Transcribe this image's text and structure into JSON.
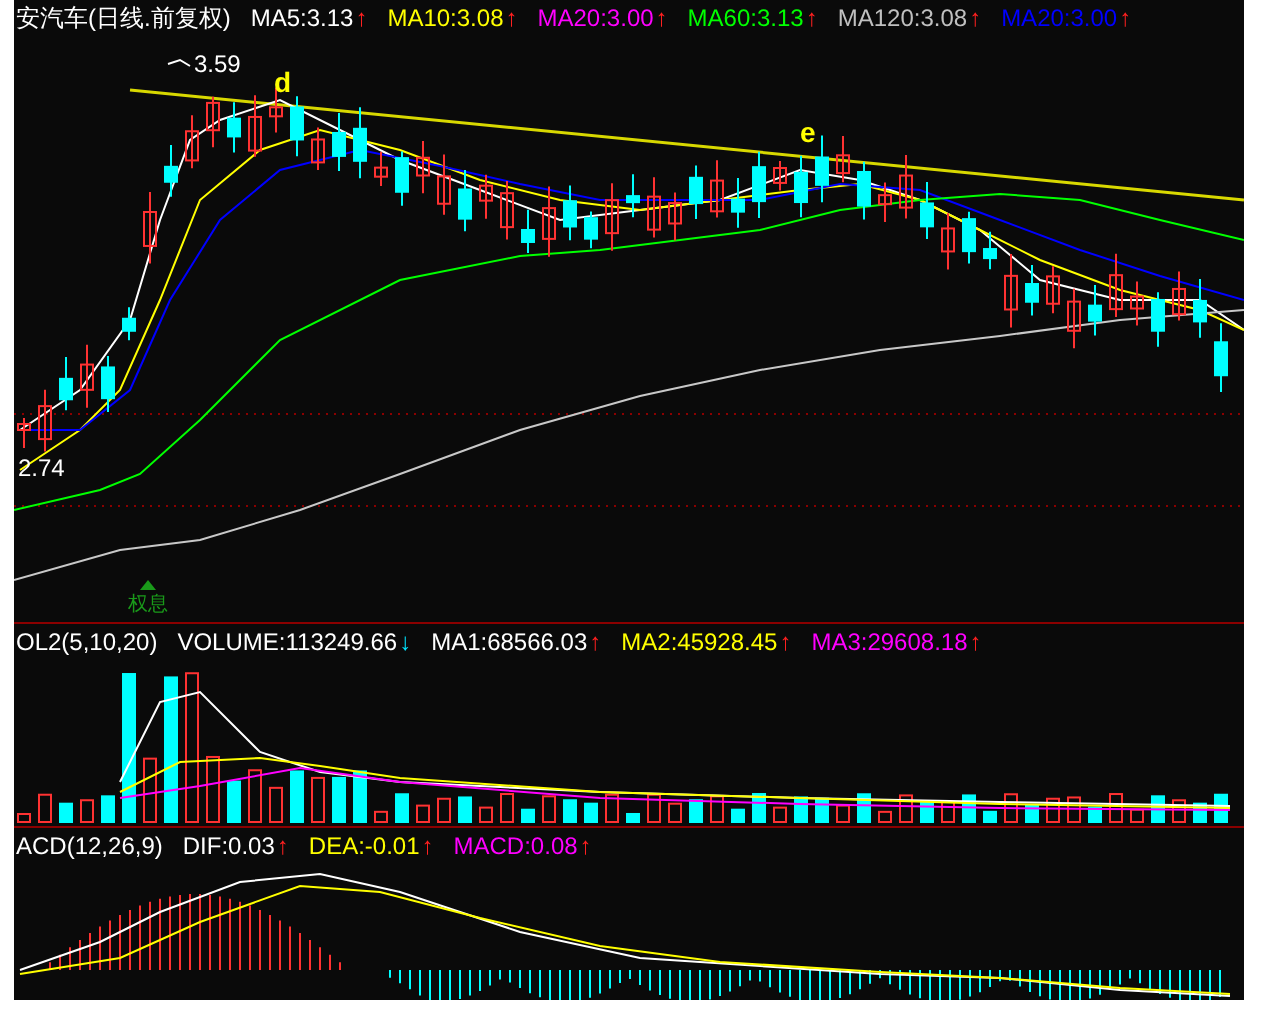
{
  "main_chart": {
    "title": "安汽车(日线.前复权)",
    "legend": [
      {
        "label": "MA5:3.13",
        "color": "#ffffff",
        "arrow": {
          "text": "↑",
          "color": "#ff2020"
        }
      },
      {
        "label": "MA10:3.08",
        "color": "#ffff00",
        "arrow": {
          "text": "↑",
          "color": "#ff2020"
        }
      },
      {
        "label": "MA20:3.00",
        "color": "#ff00ff",
        "arrow": {
          "text": "↑",
          "color": "#ff2020"
        }
      },
      {
        "label": "MA60:3.13",
        "color": "#00ff00",
        "arrow": {
          "text": "↑",
          "color": "#ff2020"
        }
      },
      {
        "label": "MA120:3.08",
        "color": "#c0c0c0",
        "arrow": {
          "text": "↑",
          "color": "#ff2020"
        }
      },
      {
        "label": "MA20:3.00",
        "color": "#0000ff",
        "arrow": {
          "text": "↑",
          "color": "#ff2020"
        }
      }
    ],
    "annotations": [
      {
        "text": "3.59",
        "kind": "high"
      },
      {
        "text": "2.74",
        "kind": "low"
      },
      {
        "text": "d",
        "kind": "wave"
      },
      {
        "text": "e",
        "kind": "wave"
      },
      {
        "text": "权息",
        "kind": "event"
      }
    ]
  },
  "volume_chart": {
    "title": "OL2(5,10,20)",
    "legend": [
      {
        "label": "VOLUME:113249.66",
        "color": "#ffffff",
        "arrow": {
          "text": "↓",
          "color": "#00e5ff"
        }
      },
      {
        "label": "MA1:68566.03",
        "color": "#ffffff",
        "arrow": {
          "text": "↑",
          "color": "#ff2020"
        }
      },
      {
        "label": "MA2:45928.45",
        "color": "#ffff00",
        "arrow": {
          "text": "↑",
          "color": "#ff2020"
        }
      },
      {
        "label": "MA3:29608.18",
        "color": "#ff00ff",
        "arrow": {
          "text": "↑",
          "color": "#ff2020"
        }
      }
    ]
  },
  "macd_chart": {
    "title": "ACD(12,26,9)",
    "legend": [
      {
        "label": "DIF:0.03",
        "color": "#ffffff",
        "arrow": {
          "text": "↑",
          "color": "#ff2020"
        }
      },
      {
        "label": "DEA:-0.01",
        "color": "#ffff00",
        "arrow": {
          "text": "↑",
          "color": "#ff2020"
        }
      },
      {
        "label": "MACD:0.08",
        "color": "#ff00ff",
        "arrow": {
          "text": "↑",
          "color": "#ff2020"
        }
      }
    ]
  }
}
